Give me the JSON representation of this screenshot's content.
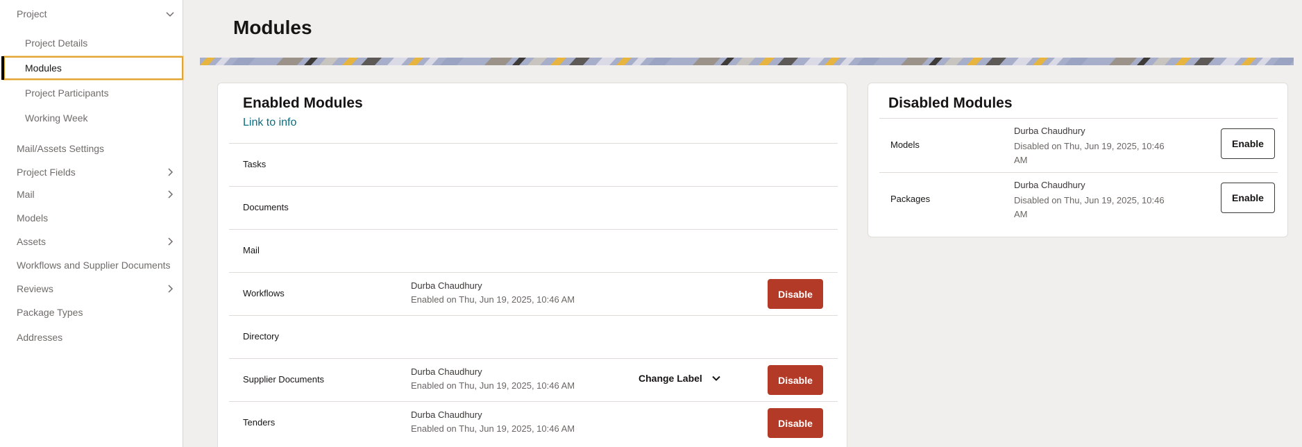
{
  "sidebar": {
    "project": {
      "label": "Project"
    },
    "project_children": [
      {
        "label": "Project Details"
      },
      {
        "label": "Modules"
      },
      {
        "label": "Project Participants"
      },
      {
        "label": "Working Week"
      }
    ],
    "items": [
      {
        "label": "Mail/Assets Settings"
      },
      {
        "label": "Project Fields"
      },
      {
        "label": "Mail"
      },
      {
        "label": "Models"
      },
      {
        "label": "Assets"
      },
      {
        "label": "Workflows and Supplier Documents"
      },
      {
        "label": "Reviews"
      },
      {
        "label": "Package Types"
      },
      {
        "label": "Addresses"
      }
    ]
  },
  "page": {
    "title": "Modules"
  },
  "enabled": {
    "title": "Enabled Modules",
    "link": "Link to info",
    "disable_label": "Disable",
    "change_label": "Change Label",
    "rows": [
      {
        "name": "Tasks"
      },
      {
        "name": "Documents"
      },
      {
        "name": "Mail"
      },
      {
        "name": "Workflows",
        "by": "Durba Chaudhury",
        "when": "Enabled on Thu, Jun 19, 2025, 10:46 AM"
      },
      {
        "name": "Directory"
      },
      {
        "name": "Supplier Documents",
        "by": "Durba Chaudhury",
        "when": "Enabled on Thu, Jun 19, 2025, 10:46 AM"
      },
      {
        "name": "Tenders",
        "by": "Durba Chaudhury",
        "when": "Enabled on Thu, Jun 19, 2025, 10:46 AM"
      }
    ]
  },
  "disabled": {
    "title": "Disabled Modules",
    "enable_label": "Enable",
    "rows": [
      {
        "name": "Models",
        "by": "Durba Chaudhury",
        "when": "Disabled on Thu, Jun 19, 2025, 10:46 AM"
      },
      {
        "name": "Packages",
        "by": "Durba Chaudhury",
        "when": "Disabled on Thu, Jun 19, 2025, 10:46 AM"
      }
    ]
  },
  "colors": {
    "accent_focus": "#e2a534",
    "danger": "#b33a26",
    "link": "#0b6d80"
  }
}
